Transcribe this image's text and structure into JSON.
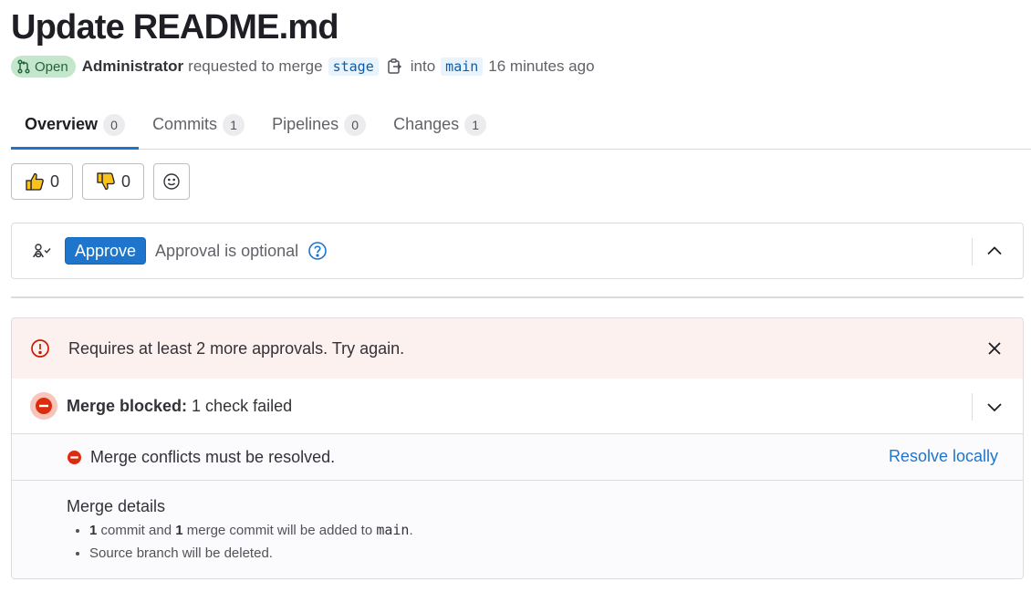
{
  "title": "Update README.md",
  "meta": {
    "status": "Open",
    "author": "Administrator",
    "requested_text": "requested to merge",
    "source_branch": "stage",
    "into_text": "into",
    "target_branch": "main",
    "time": "16 minutes ago"
  },
  "tabs": [
    {
      "label": "Overview",
      "count": "0"
    },
    {
      "label": "Commits",
      "count": "1"
    },
    {
      "label": "Pipelines",
      "count": "0"
    },
    {
      "label": "Changes",
      "count": "1"
    }
  ],
  "reactions": {
    "thumbs_up": "0",
    "thumbs_down": "0"
  },
  "approval": {
    "button": "Approve",
    "text": "Approval is optional"
  },
  "widget": {
    "alert": "Requires at least 2 more approvals. Try again.",
    "blocked_label": "Merge blocked:",
    "blocked_detail": "1 check failed",
    "conflict_text": "Merge conflicts must be resolved.",
    "resolve_link": "Resolve locally",
    "details_title": "Merge details",
    "detail_1": {
      "count1": "1",
      "text1": "commit and",
      "count2": "1",
      "text2": "merge commit will be added to",
      "branch": "main",
      "end": "."
    },
    "detail_2": "Source branch will be deleted."
  },
  "colors": {
    "accent": "#1f75cb",
    "open_badge_bg": "#c3e6cd",
    "danger": "#dd2b0e",
    "alert_bg": "#fcf1ef"
  }
}
